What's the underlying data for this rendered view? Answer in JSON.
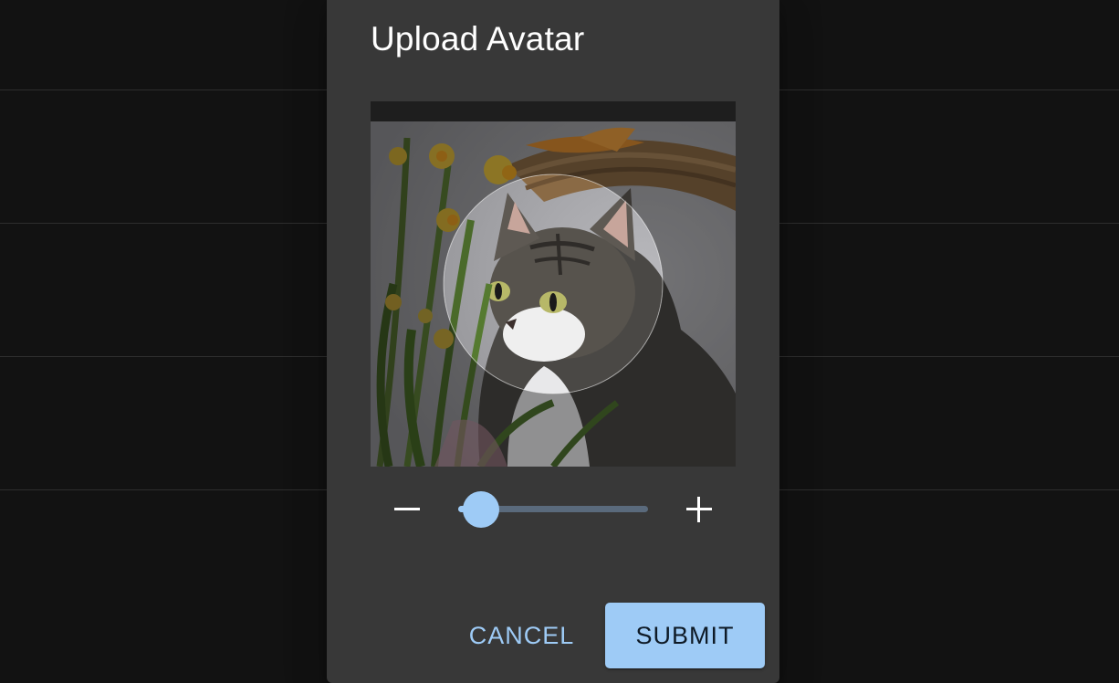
{
  "dialog": {
    "title": "Upload Avatar"
  },
  "cropper": {
    "image_description_icon": "cat-photo",
    "crop_shape": "circle"
  },
  "zoom": {
    "minus_icon": "minus-icon",
    "plus_icon": "plus-icon",
    "level_fraction": 0.12
  },
  "actions": {
    "cancel_label": "CANCEL",
    "submit_label": "SUBMIT"
  },
  "colors": {
    "accent": "#9ecbf6",
    "dialog_bg": "#383838",
    "backdrop": "#121212"
  }
}
